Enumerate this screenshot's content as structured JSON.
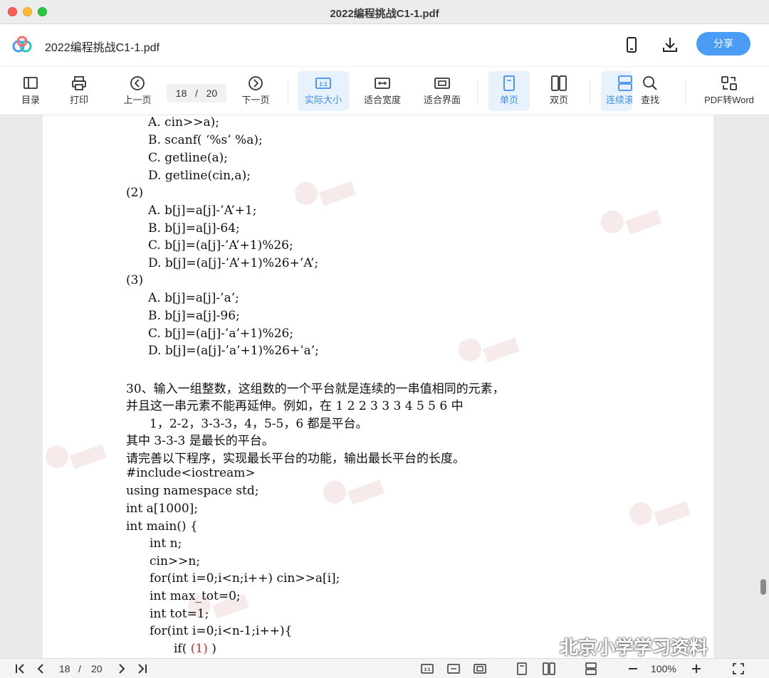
{
  "window": {
    "title": "2022编程挑战C1-1.pdf"
  },
  "header": {
    "doc_name": "2022编程挑战C1-1.pdf",
    "share_label": "分享"
  },
  "toolbar": {
    "toc": "目录",
    "print": "打印",
    "prev": "上一页",
    "current_page": "18",
    "slash": "/",
    "total_pages": "20",
    "next": "下一页",
    "actual_size": "实际大小",
    "fit_width": "适合宽度",
    "fit_page": "适合界面",
    "single_page": "单页",
    "double_page": "双页",
    "continuous": "连续滚",
    "find": "查找",
    "pdf_to_word": "PDF转Word"
  },
  "document": {
    "lines": [
      "A. cin>>a);",
      "B. scanf( ‘%s’ %a);",
      "C. getline(a);",
      "D. getline(cin,a);",
      "(2)",
      "A. b[j]=a[j]-’A’+1;",
      "B. b[j]=a[j]-64;",
      "C. b[j]=(a[j]-’A’+1)%26;",
      "D. b[j]=(a[j]-’A’+1)%26+’A’;",
      "(3)",
      "A. b[j]=a[j]-’a’;",
      "B. b[j]=a[j]-96;",
      "C. b[j]=(a[j]-’a’+1)%26;",
      "D. b[j]=(a[j]-’a’+1)%26+’a’;",
      "30、输入一组整数，这组数的一个平台就是连续的一串值相同的元素，",
      "并且这一串元素不能再延伸。例如，在 1 2 2 3 3 3 4 5 5 6 中",
      "1，2-2，3-3-3，4，5-5，6 都是平台。",
      "其中 3-3-3 是最长的平台。",
      "请完善以下程序，实现最长平台的功能，输出最长平台的长度。",
      "#include<iostream>",
      "using namespace std;",
      "int a[1000];",
      "int main() {",
      "int n;",
      "cin>>n;",
      "for(int i=0;i<n;i++) cin>>a[i];",
      "int max_tot=0;",
      "int tot=1;",
      "for(int i=0;i<n-1;i++){",
      "if( ",
      "(1)",
      " )"
    ],
    "wechat_overlay": "北京小学学习资料"
  },
  "bottombar": {
    "current_page": "18",
    "slash": "/",
    "total_pages": "20",
    "zoom": "100%"
  },
  "colors": {
    "accent": "#4b9cf5",
    "active_bg": "#e8f2fe",
    "answer_red": "#d6282c"
  }
}
